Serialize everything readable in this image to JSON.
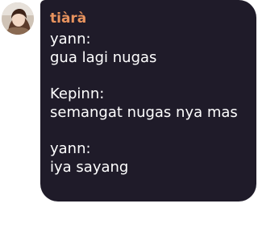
{
  "sender": {
    "name": "tiàrà",
    "name_color": "#e8935e",
    "avatar_icon": "user-avatar-photo"
  },
  "bubble": {
    "background_color": "#1f1b29",
    "text_color": "#ffffff"
  },
  "messages": [
    {
      "who": "yann:",
      "text": "gua lagi nugas"
    },
    {
      "who": "Kepinn:",
      "text": "semangat nugas nya mas"
    },
    {
      "who": "yann:",
      "text": "iya sayang"
    }
  ]
}
